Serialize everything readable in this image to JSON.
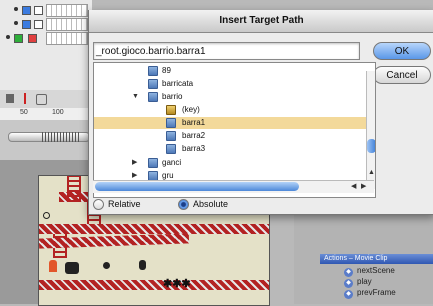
{
  "dialog": {
    "title": "Insert Target Path",
    "path_value": "_root.gioco.barrio.barra1",
    "ok_label": "OK",
    "cancel_label": "Cancel"
  },
  "tree": {
    "items": [
      {
        "label": "89",
        "level": 2,
        "expanded": false,
        "icon": "movieclip-icon"
      },
      {
        "label": "barricata",
        "level": 2,
        "expanded": false,
        "icon": "movieclip-icon"
      },
      {
        "label": "barrio",
        "level": 2,
        "expanded": true,
        "icon": "movieclip-icon"
      },
      {
        "label": "(key)",
        "level": 3,
        "expanded": false,
        "icon": "key-icon"
      },
      {
        "label": "barra1",
        "level": 3,
        "expanded": false,
        "icon": "movieclip-icon",
        "selected": true
      },
      {
        "label": "barra2",
        "level": 3,
        "expanded": false,
        "icon": "movieclip-icon"
      },
      {
        "label": "barra3",
        "level": 3,
        "expanded": false,
        "icon": "movieclip-icon"
      },
      {
        "label": "ganci",
        "level": 2,
        "expanded": false,
        "collapsed_arrow": true,
        "icon": "movieclip-icon"
      },
      {
        "label": "gru",
        "level": 2,
        "expanded": false,
        "collapsed_arrow": true,
        "icon": "movieclip-icon"
      }
    ]
  },
  "mode": {
    "relative_label": "Relative",
    "absolute_label": "Absolute",
    "selected": "absolute"
  },
  "background": {
    "ruler_ticks": [
      "50",
      "100"
    ],
    "actions_header": "Actions – Movie Clip",
    "actions_items": [
      "nextScene",
      "play",
      "prevFrame"
    ],
    "game_glyphs": "✱✱✱"
  },
  "colors": {
    "selection": "#f3d99a",
    "ok_button": "#5a97e8",
    "girder": "#b32222"
  }
}
